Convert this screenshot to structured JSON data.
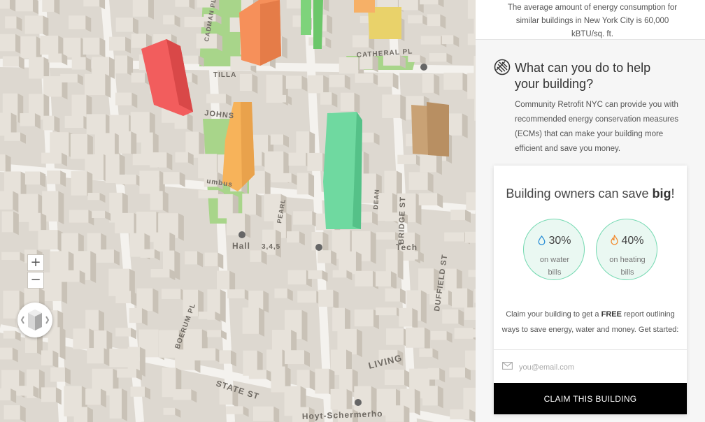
{
  "map": {
    "street_labels": [
      "STATE ST",
      "LIVING",
      "DUFFIELD ST",
      "BRIDGE ST",
      "Tech",
      "Hall",
      "JOHNS",
      "CATHERAL PL",
      "Hoyt-Schermerho",
      "umbus",
      "TILLA",
      "3,4,5",
      "CADMAN PLAZA",
      "BOERUM PL",
      "PEARL",
      "DEAN"
    ],
    "zoom_in_label": "+",
    "zoom_out_label": "−",
    "compass_icon": "building-3d-icon",
    "building_colors": {
      "red": "#f25d5d",
      "orange": "#f6905a",
      "light_orange": "#f7b35a",
      "yellow": "#e9d26a",
      "green": "#6fd9a0",
      "brown": "#c9a275"
    }
  },
  "panel": {
    "intro_text": "The average amount of energy consumption for similar buildings in New York City is 60,000 kBTU/sq. ft.",
    "help_title": "What can you do to help your building?",
    "help_body": "Community Retrofit NYC can provide you with recommended energy conservation measures (ECMs) that can make your building more efficient and save you money.",
    "card": {
      "title_prefix": "Building owners can save ",
      "title_emphasis": "big",
      "title_suffix": "!",
      "stats": [
        {
          "value": "30%",
          "label": "on water bills",
          "icon": "water-drop-icon",
          "icon_color": "#2a8fd6"
        },
        {
          "value": "40%",
          "label": "on heating bills",
          "icon": "flame-icon",
          "icon_color": "#f28a2e"
        }
      ],
      "body_prefix": "Claim your building to get a ",
      "body_emphasis": "FREE",
      "body_suffix": " report outlining ways to save energy, water and money. Get started:",
      "email_placeholder": "you@email.com",
      "claim_label": "CLAIM THIS BUILDING"
    },
    "accent_color": "#74d9b1"
  }
}
